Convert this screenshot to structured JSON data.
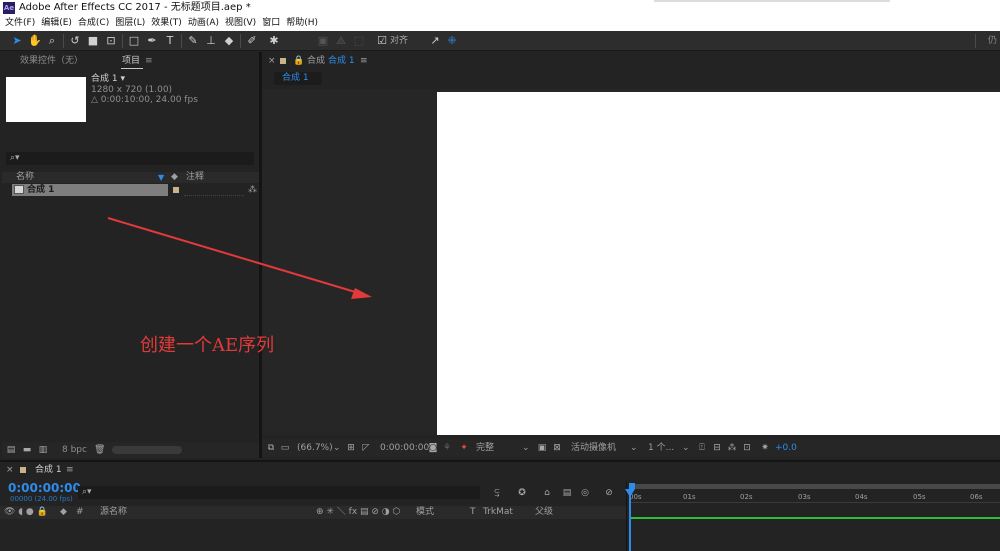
{
  "window": {
    "title": "Adobe After Effects CC 2017 - 无标题项目.aep *",
    "logo": "Ae"
  },
  "menu": [
    "文件(F)",
    "编辑(E)",
    "合成(C)",
    "图层(L)",
    "效果(T)",
    "动画(A)",
    "视图(V)",
    "窗口",
    "帮助(H)"
  ],
  "toolbar": {
    "align_label": "对齐",
    "right_clip": "仍"
  },
  "left_panel": {
    "tab_effects": "效果控件（无）",
    "tab_project": "项目",
    "comp_name": "合成 1 ▾",
    "comp_size": "1280 x 720 (1.00)",
    "comp_duration": "△ 0:00:10:00, 24.00 fps",
    "search_icon": "⌕▾",
    "col_name": "名称",
    "col_comment": "注释",
    "item_name": "合成 1",
    "footer_bpc": "8 bpc"
  },
  "comp_panel": {
    "tab_label": "合成",
    "tab_name": "合成 1",
    "sub_tab": "合成 1",
    "zoom": "(66.7%)",
    "timecode": "0:00:00:00",
    "resolution": "完整",
    "camera": "活动摄像机",
    "views": "1 个...",
    "exposure": "+0.0"
  },
  "annotation": {
    "text": "创建一个AE序列",
    "color": "#e23a3a"
  },
  "timeline": {
    "tab_name": "合成 1",
    "timecode": "0:00:00:00",
    "frames": "00000 (24.00 fps)",
    "col_source": "源名称",
    "col_mode": "模式",
    "col_t": "T",
    "col_trkmat": "TrkMat",
    "col_parent": "父级",
    "ruler": [
      "00s",
      "01s",
      "02s",
      "03s",
      "04s",
      "05s",
      "06s"
    ]
  }
}
